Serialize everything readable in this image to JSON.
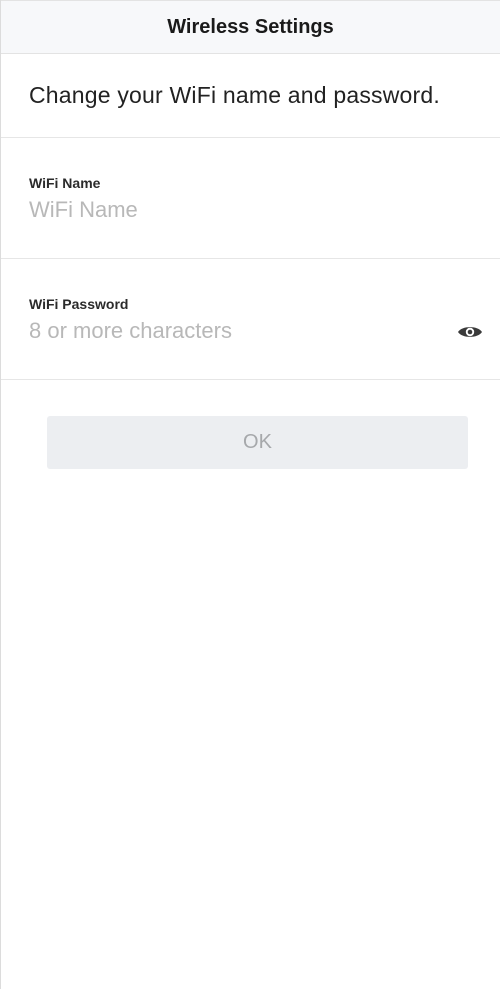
{
  "header": {
    "title": "Wireless Settings"
  },
  "intro": {
    "text": "Change your WiFi name and password."
  },
  "wifi_name": {
    "label": "WiFi Name",
    "value": "",
    "placeholder": "WiFi Name"
  },
  "wifi_password": {
    "label": "WiFi Password",
    "value": "",
    "placeholder": "8 or more characters",
    "visibility_icon": "eye-icon"
  },
  "actions": {
    "ok_label": "OK"
  },
  "colors": {
    "header_bg": "#f7f8fa",
    "button_bg": "#eceef1",
    "button_text": "#a6a8ab",
    "placeholder": "#b8b8b8"
  }
}
